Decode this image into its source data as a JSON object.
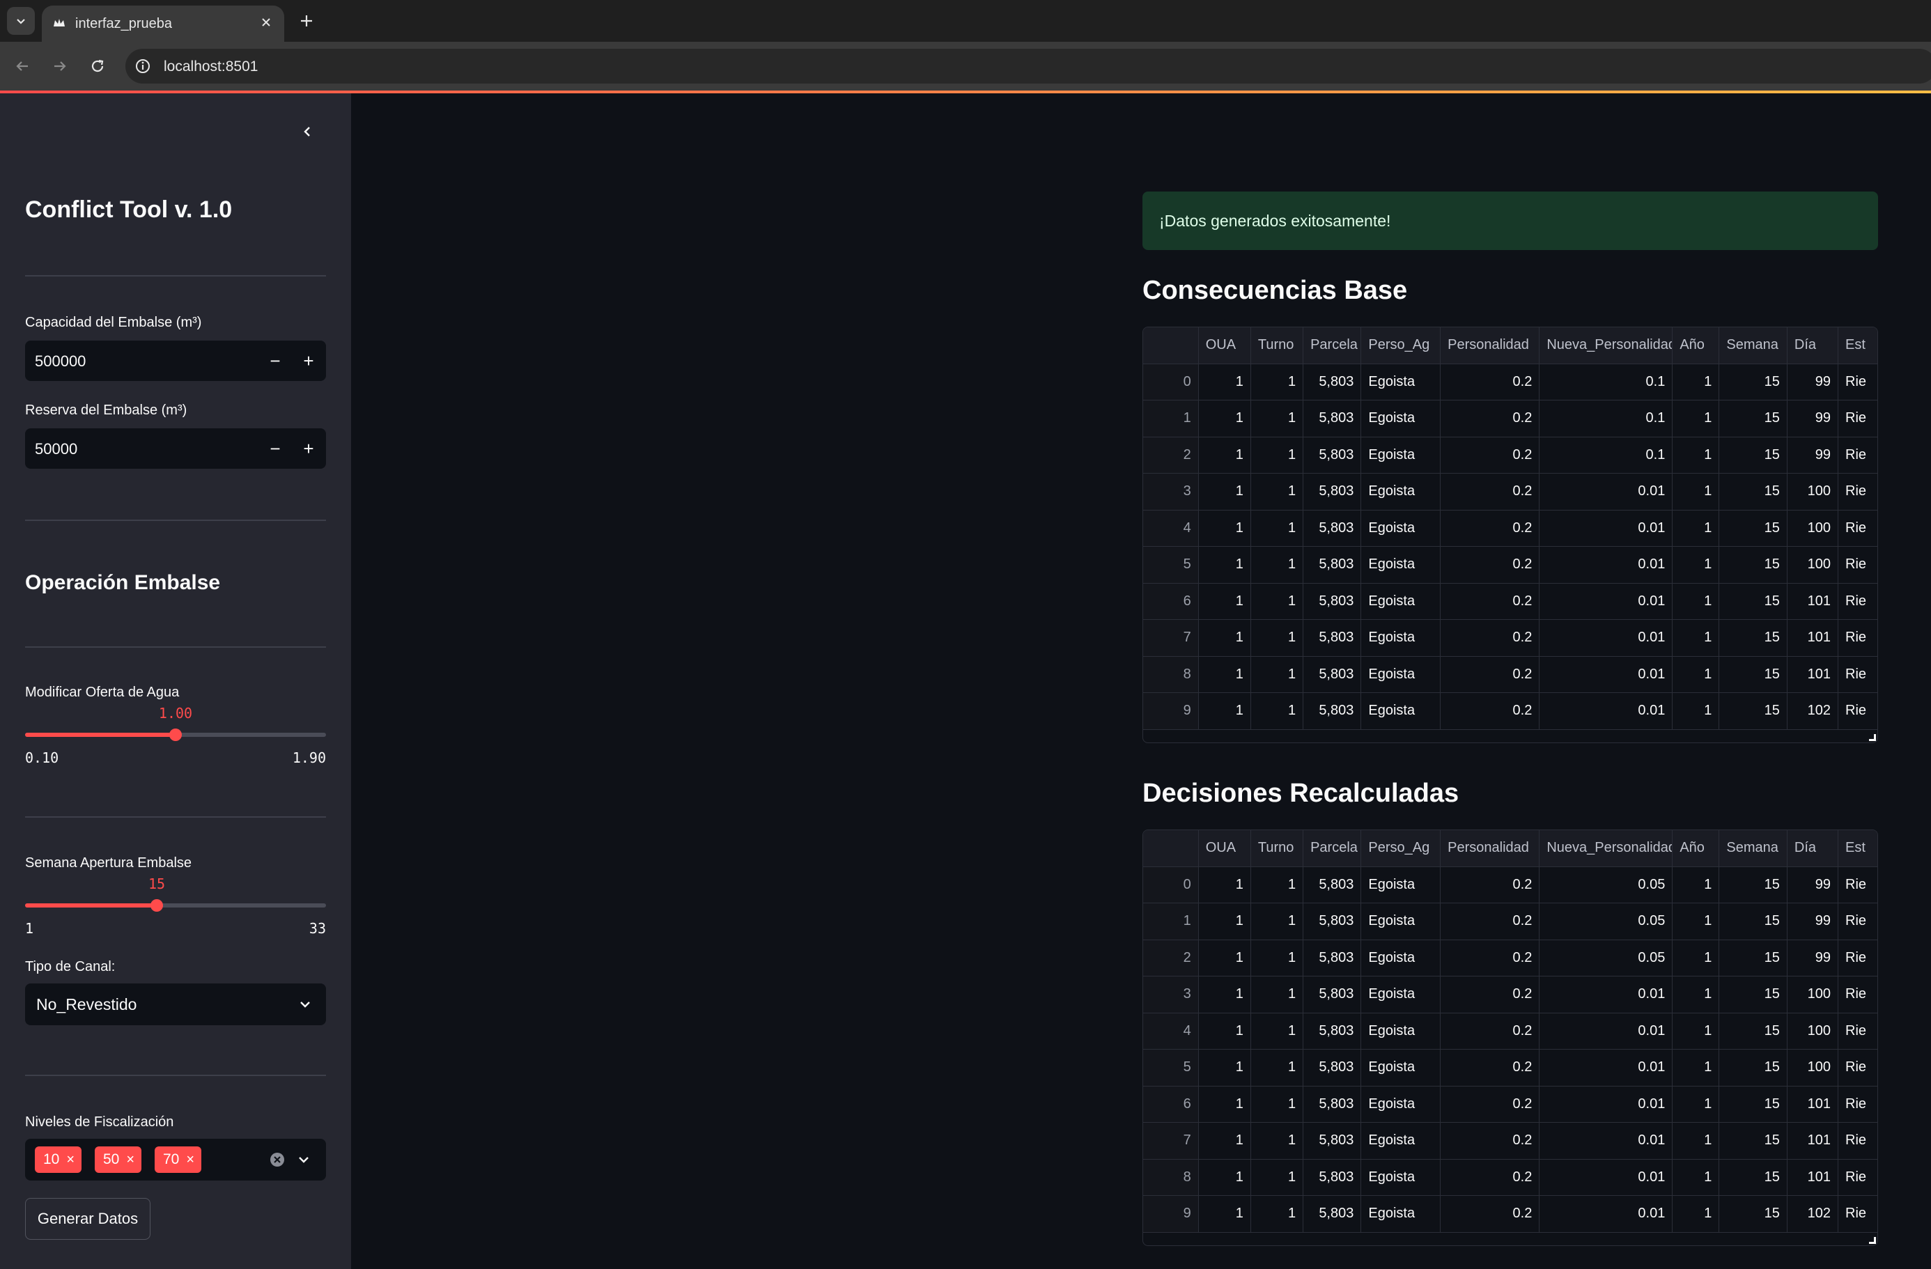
{
  "browser": {
    "tab_title": "interfaz_prueba",
    "url": "localhost:8501"
  },
  "colors": {
    "accent": "#ff4b4b",
    "sidebar_bg": "#262730",
    "main_bg": "#0e1117",
    "success_bg": "#173928"
  },
  "sidebar": {
    "title": "Conflict Tool v. 1.0",
    "capacidad": {
      "label": "Capacidad del Embalse (m³)",
      "value": "500000"
    },
    "reserva": {
      "label": "Reserva del Embalse (m³)",
      "value": "50000"
    },
    "operacion_title": "Operación Embalse",
    "oferta": {
      "label": "Modificar Oferta de Agua",
      "value": "1.00",
      "min": "0.10",
      "max": "1.90",
      "fraction": 0.5
    },
    "semana": {
      "label": "Semana Apertura Embalse",
      "value": "15",
      "min": "1",
      "max": "33",
      "fraction": 0.4375
    },
    "canal": {
      "label": "Tipo de Canal:",
      "value": "No_Revestido"
    },
    "fiscalizacion": {
      "label": "Niveles de Fiscalización",
      "chips": [
        "10",
        "50",
        "70"
      ]
    },
    "generate_label": "Generar Datos"
  },
  "main": {
    "success_message": "¡Datos generados exitosamente!",
    "table1_title": "Consecuencias Base",
    "table2_title": "Decisiones Recalculadas",
    "columns": [
      "",
      "OUA",
      "Turno",
      "Parcela",
      "Perso_Ag",
      "Personalidad",
      "Nueva_Personalidad",
      "Año",
      "Semana",
      "Día",
      "Est"
    ],
    "table1_rows": [
      [
        "0",
        "1",
        "1",
        "5,803",
        "Egoista",
        "0.2",
        "0.1",
        "1",
        "15",
        "99",
        "Rie"
      ],
      [
        "1",
        "1",
        "1",
        "5,803",
        "Egoista",
        "0.2",
        "0.1",
        "1",
        "15",
        "99",
        "Rie"
      ],
      [
        "2",
        "1",
        "1",
        "5,803",
        "Egoista",
        "0.2",
        "0.1",
        "1",
        "15",
        "99",
        "Rie"
      ],
      [
        "3",
        "1",
        "1",
        "5,803",
        "Egoista",
        "0.2",
        "0.01",
        "1",
        "15",
        "100",
        "Rie"
      ],
      [
        "4",
        "1",
        "1",
        "5,803",
        "Egoista",
        "0.2",
        "0.01",
        "1",
        "15",
        "100",
        "Rie"
      ],
      [
        "5",
        "1",
        "1",
        "5,803",
        "Egoista",
        "0.2",
        "0.01",
        "1",
        "15",
        "100",
        "Rie"
      ],
      [
        "6",
        "1",
        "1",
        "5,803",
        "Egoista",
        "0.2",
        "0.01",
        "1",
        "15",
        "101",
        "Rie"
      ],
      [
        "7",
        "1",
        "1",
        "5,803",
        "Egoista",
        "0.2",
        "0.01",
        "1",
        "15",
        "101",
        "Rie"
      ],
      [
        "8",
        "1",
        "1",
        "5,803",
        "Egoista",
        "0.2",
        "0.01",
        "1",
        "15",
        "101",
        "Rie"
      ],
      [
        "9",
        "1",
        "1",
        "5,803",
        "Egoista",
        "0.2",
        "0.01",
        "1",
        "15",
        "102",
        "Rie"
      ]
    ],
    "table2_rows": [
      [
        "0",
        "1",
        "1",
        "5,803",
        "Egoista",
        "0.2",
        "0.05",
        "1",
        "15",
        "99",
        "Rie"
      ],
      [
        "1",
        "1",
        "1",
        "5,803",
        "Egoista",
        "0.2",
        "0.05",
        "1",
        "15",
        "99",
        "Rie"
      ],
      [
        "2",
        "1",
        "1",
        "5,803",
        "Egoista",
        "0.2",
        "0.05",
        "1",
        "15",
        "99",
        "Rie"
      ],
      [
        "3",
        "1",
        "1",
        "5,803",
        "Egoista",
        "0.2",
        "0.01",
        "1",
        "15",
        "100",
        "Rie"
      ],
      [
        "4",
        "1",
        "1",
        "5,803",
        "Egoista",
        "0.2",
        "0.01",
        "1",
        "15",
        "100",
        "Rie"
      ],
      [
        "5",
        "1",
        "1",
        "5,803",
        "Egoista",
        "0.2",
        "0.01",
        "1",
        "15",
        "100",
        "Rie"
      ],
      [
        "6",
        "1",
        "1",
        "5,803",
        "Egoista",
        "0.2",
        "0.01",
        "1",
        "15",
        "101",
        "Rie"
      ],
      [
        "7",
        "1",
        "1",
        "5,803",
        "Egoista",
        "0.2",
        "0.01",
        "1",
        "15",
        "101",
        "Rie"
      ],
      [
        "8",
        "1",
        "1",
        "5,803",
        "Egoista",
        "0.2",
        "0.01",
        "1",
        "15",
        "101",
        "Rie"
      ],
      [
        "9",
        "1",
        "1",
        "5,803",
        "Egoista",
        "0.2",
        "0.01",
        "1",
        "15",
        "102",
        "Rie"
      ]
    ]
  }
}
